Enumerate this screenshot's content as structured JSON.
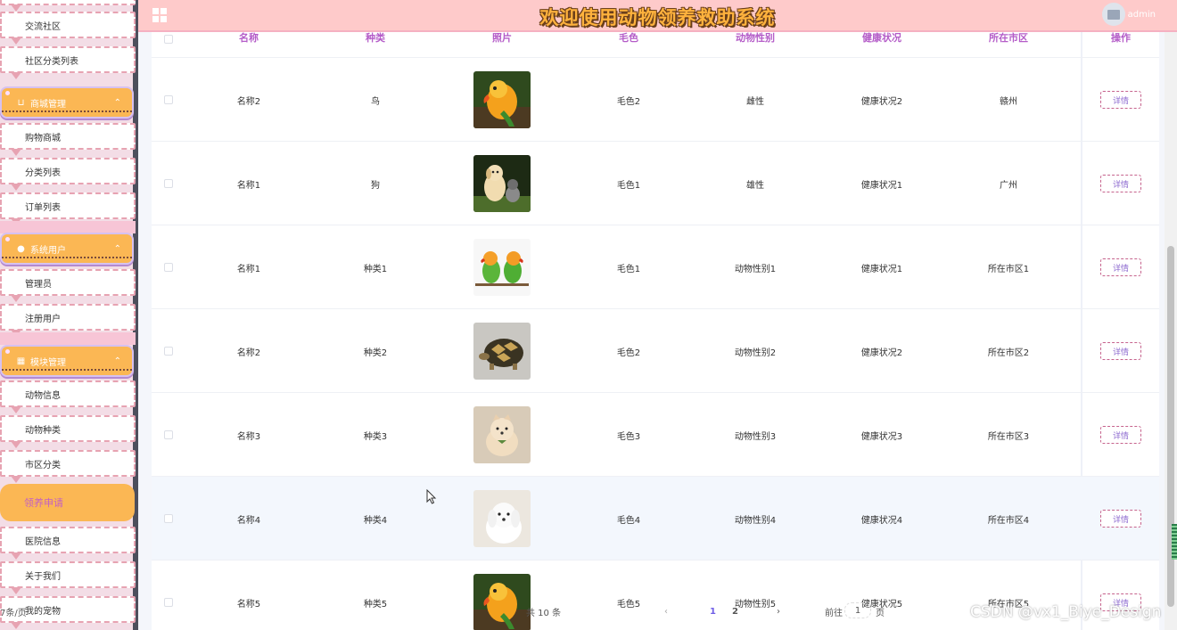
{
  "header": {
    "title": "欢迎使用动物领养救助系统",
    "user_name": "admin"
  },
  "sidebar": {
    "top_items": [
      "交流社区",
      "社区分类列表"
    ],
    "groups": [
      {
        "label": "商城管理",
        "icon": "cart-icon",
        "items": [
          "购物商城",
          "分类列表",
          "订单列表"
        ]
      },
      {
        "label": "系统用户",
        "icon": "user-icon",
        "items": [
          "管理员",
          "注册用户"
        ]
      },
      {
        "label": "模块管理",
        "icon": "grid-icon",
        "items": [
          "动物信息",
          "动物种类",
          "市区分类"
        ]
      }
    ],
    "active_item": "领养申请",
    "bottom_items": [
      "医院信息",
      "关于我们",
      "我的宠物"
    ]
  },
  "table": {
    "columns": [
      "名称",
      "种类",
      "照片",
      "毛色",
      "动物性别",
      "健康状况",
      "所在市区",
      "操作"
    ],
    "detail_label": "详情",
    "rows": [
      {
        "name": "名称2",
        "kind": "鸟",
        "photo": "parrot-photo",
        "fur": "毛色2",
        "sex": "雌性",
        "health": "健康状况2",
        "city": "赣州"
      },
      {
        "name": "名称1",
        "kind": "狗",
        "photo": "puppies-photo",
        "fur": "毛色1",
        "sex": "雄性",
        "health": "健康状况1",
        "city": "广州"
      },
      {
        "name": "名称1",
        "kind": "种类1",
        "photo": "lovebirds-photo",
        "fur": "毛色1",
        "sex": "动物性别1",
        "health": "健康状况1",
        "city": "所在市区1"
      },
      {
        "name": "名称2",
        "kind": "种类2",
        "photo": "tortoise-photo",
        "fur": "毛色2",
        "sex": "动物性别2",
        "health": "健康状况2",
        "city": "所在市区2"
      },
      {
        "name": "名称3",
        "kind": "种类3",
        "photo": "pomeranian-photo",
        "fur": "毛色3",
        "sex": "动物性别3",
        "health": "健康状况3",
        "city": "所在市区3"
      },
      {
        "name": "名称4",
        "kind": "种类4",
        "photo": "maltese-photo",
        "fur": "毛色4",
        "sex": "动物性别4",
        "health": "健康状况4",
        "city": "所在市区4"
      },
      {
        "name": "名称5",
        "kind": "种类5",
        "photo": "parrot-photo",
        "fur": "毛色5",
        "sex": "动物性别5",
        "health": "健康状况5",
        "city": "所在市区5"
      }
    ]
  },
  "pagination": {
    "total": "共 10 条",
    "page_size": "7条/页",
    "prev": "‹",
    "pages": [
      "1",
      "2"
    ],
    "next": "›",
    "goto_label": "前往",
    "goto_value": "1",
    "page_suffix": "页"
  },
  "watermark": "CSDN @vx1_Biye_Design"
}
